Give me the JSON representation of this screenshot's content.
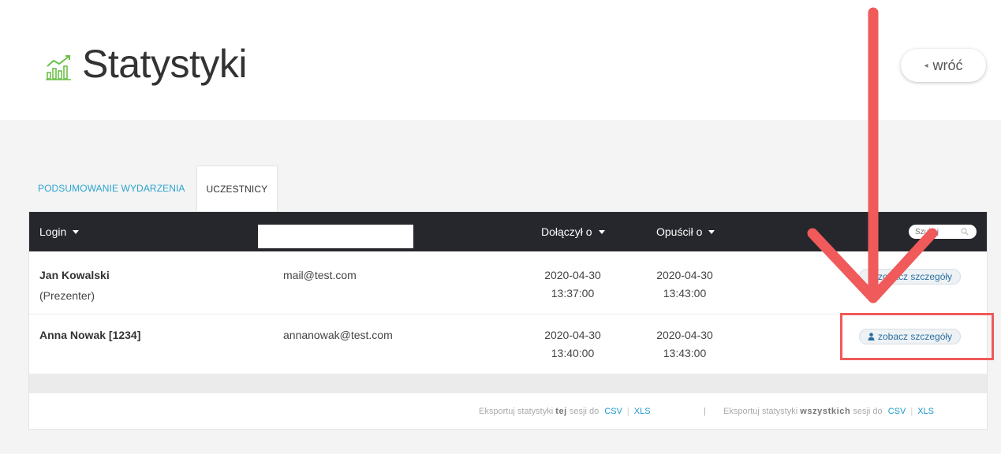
{
  "header": {
    "title": "Statystyki",
    "back_label": "wróć"
  },
  "tabs": [
    {
      "label": "PODSUMOWANIE WYDARZENIA",
      "active": false
    },
    {
      "label": "UCZESTNICY",
      "active": true
    }
  ],
  "table": {
    "columns": {
      "login": "Login",
      "joined": "Dołączył o",
      "left": "Opuścił o"
    },
    "search_placeholder": "Szukaj",
    "rows": [
      {
        "name": "Jan Kowalski",
        "role": "(Prezenter)",
        "email": "mail@test.com",
        "joined_date": "2020-04-30",
        "joined_time": "13:37:00",
        "left_date": "2020-04-30",
        "left_time": "13:43:00",
        "details_label": "zobacz szczegóły"
      },
      {
        "name": "Anna Nowak [1234]",
        "role": "",
        "email": "annanowak@test.com",
        "joined_date": "2020-04-30",
        "joined_time": "13:40:00",
        "left_date": "2020-04-30",
        "left_time": "13:43:00",
        "details_label": "zobacz szczegóły"
      }
    ]
  },
  "export": {
    "this_prefix": "Eksportuj statystyki",
    "this_bold": "tej",
    "this_suffix": "sesji do",
    "all_prefix": "Eksportuj statystyki",
    "all_bold": "wszystkich",
    "all_suffix": "sesji do",
    "csv": "CSV",
    "xls": "XLS",
    "separator": "|"
  },
  "colors": {
    "accent": "#2aa3cf",
    "header_bg": "#25272c",
    "annotation": "#f05a5a",
    "icon_green": "#6cc04a"
  },
  "icons": {
    "title": "bar-chart-trend-icon",
    "back": "caret-left-icon",
    "search": "search-icon",
    "details": "person-icon"
  }
}
